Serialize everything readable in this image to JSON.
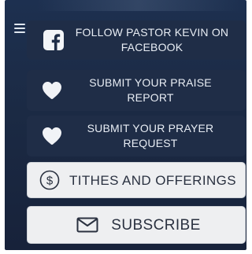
{
  "menu": {
    "icon": "hamburger-menu-icon"
  },
  "buttons": {
    "facebook": {
      "label": "FOLLOW PASTOR KEVIN ON FACEBOOK",
      "icon": "facebook-icon"
    },
    "praise": {
      "label": "SUBMIT YOUR PRAISE REPORT",
      "icon": "heart-icon"
    },
    "prayer": {
      "label": "SUBMIT YOUR PRAYER REQUEST",
      "icon": "heart-icon"
    },
    "tithes": {
      "label": "TITHES AND OFFERINGS",
      "icon": "dollar-circle-icon"
    },
    "subscribe": {
      "label": "SUBSCRIBE",
      "icon": "envelope-icon"
    }
  },
  "colors": {
    "panel_bg": "#1b2a44",
    "dark_button_bg": "#1f2d47",
    "light_button_bg": "#eeeff1",
    "light_text": "#e8edf4",
    "dark_text": "#2a3140"
  }
}
